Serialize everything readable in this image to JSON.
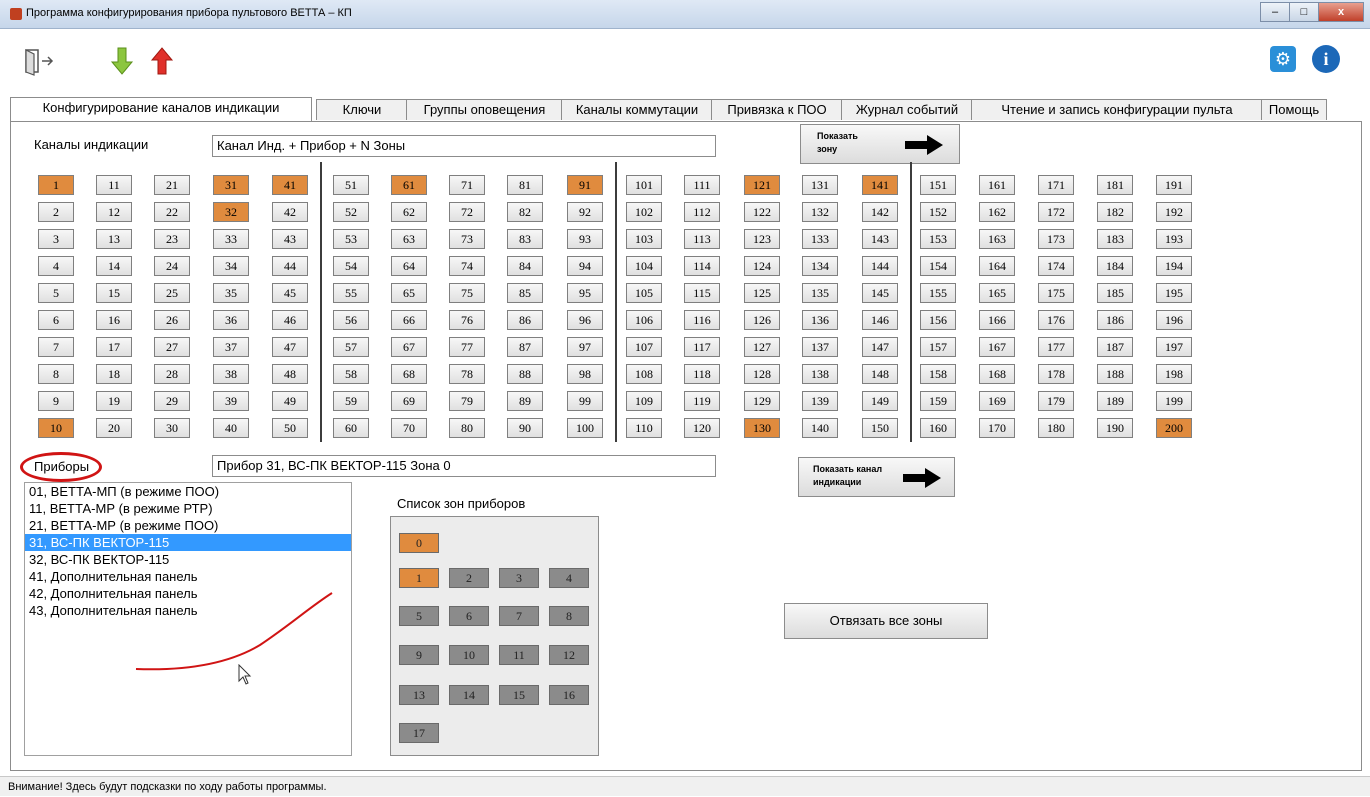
{
  "window": {
    "title": "Программа конфигурирования прибора пультового ВЕТТА – КП"
  },
  "toolbar": {
    "icons": [
      "exit-icon",
      "download-arrow-icon",
      "upload-arrow-icon",
      "settings-icon",
      "info-icon"
    ]
  },
  "tabs": [
    {
      "label": "Конфигурирование каналов индикации",
      "active": true
    },
    {
      "label": "Ключи"
    },
    {
      "label": "Группы оповещения"
    },
    {
      "label": "Каналы коммутации"
    },
    {
      "label": "Привязка к ПОО"
    },
    {
      "label": "Журнал событий"
    },
    {
      "label": "Чтение и запись конфигурации пульта"
    },
    {
      "label": "Помощь"
    }
  ],
  "channels": {
    "label": "Каналы индикации",
    "field_value": "Канал Инд. + Прибор + N Зоны",
    "show_zone_button": "Показать зону",
    "active": [
      1,
      10,
      31,
      32,
      41,
      61,
      91,
      121,
      130,
      141,
      200
    ]
  },
  "devices": {
    "label": "Приборы",
    "field_value": "Прибор 31, ВС-ПК ВЕКТОР-115  Зона 0",
    "show_channel_button": "Показать канал индикации",
    "items": [
      "01, ВЕТТА-МП (в режиме ПОО)",
      "11, ВЕТТА-МР (в режиме РТР)",
      "21, ВЕТТА-МР (в режиме ПОО)",
      "31, ВС-ПК ВЕКТОР-115",
      "32, ВС-ПК ВЕКТОР-115",
      "41, Дополнительная панель",
      "42, Дополнительная панель",
      "43, Дополнительная панель"
    ],
    "selected_index": 3
  },
  "zones": {
    "label": "Список зон приборов",
    "items": [
      "0",
      "1",
      "2",
      "3",
      "4",
      "5",
      "6",
      "7",
      "8",
      "9",
      "10",
      "11",
      "12",
      "13",
      "14",
      "15",
      "16",
      "17"
    ],
    "active": [
      "0",
      "1"
    ]
  },
  "unbind_button": "Отвязать все зоны",
  "status": "Внимание! Здесь будут подсказки по ходу работы программы.",
  "colors": {
    "active": "#e08b3e",
    "selection": "#3399ff",
    "annotation": "#d01414"
  }
}
